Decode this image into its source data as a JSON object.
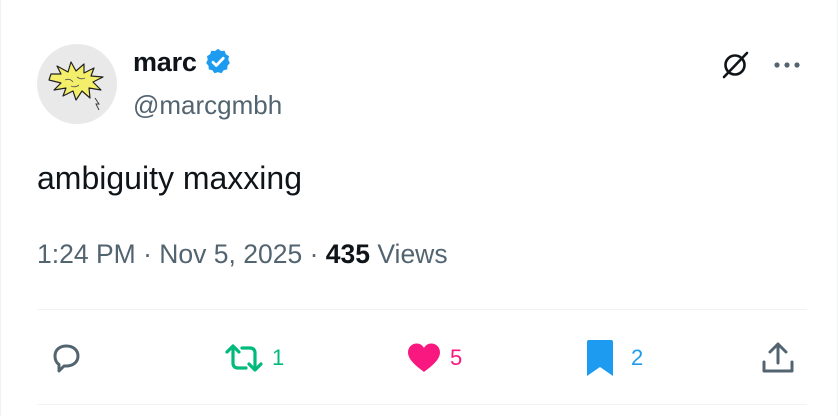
{
  "author": {
    "name": "marc",
    "handle": "@marcgmbh"
  },
  "tweet": {
    "text": "ambiguity maxxing"
  },
  "meta": {
    "time": "1:24 PM",
    "separator": "·",
    "date": "Nov 5, 2025",
    "views_count": "435",
    "views_label": "Views"
  },
  "actions": {
    "reply_count": "",
    "retweet_count": "1",
    "like_count": "5",
    "bookmark_count": "2"
  },
  "colors": {
    "verified": "#1d9bf0",
    "retweet": "#00ba7c",
    "like": "#f91880",
    "bookmark": "#1d9bf0",
    "secondary_text": "#536471"
  },
  "icons": [
    "avatar-burst",
    "verified-badge-icon",
    "grok-icon",
    "more-icon",
    "reply-icon",
    "retweet-icon",
    "heart-icon",
    "bookmark-icon",
    "share-icon"
  ]
}
